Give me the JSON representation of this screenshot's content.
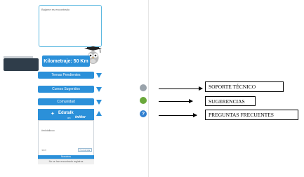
{
  "notes": {
    "text": "Bajame es encontrado"
  },
  "kilometraje": {
    "label": "Kilometraje: 50 Km"
  },
  "menu": [
    {
      "label": "Temas Pendientes"
    },
    {
      "label": "Cursos Sugeridos"
    },
    {
      "label": "Comunidad"
    }
  ],
  "twitter": {
    "handle": "Edutalk",
    "on_label": "on",
    "service": "twitter",
    "input_label": "#edutalkcco",
    "count": "140",
    "send_label": "Comentar",
    "strip_label": "Nosotros",
    "footer": "No se han encontrado registros"
  },
  "callouts": {
    "support": "SOPORTE TÉCNICO",
    "suggestions": "SUGERENCIAS",
    "faq": "PREGUNTAS FRECUENTES"
  },
  "colors": {
    "accent": "#2b90d9",
    "dark_tab": "#2f3d4a"
  }
}
